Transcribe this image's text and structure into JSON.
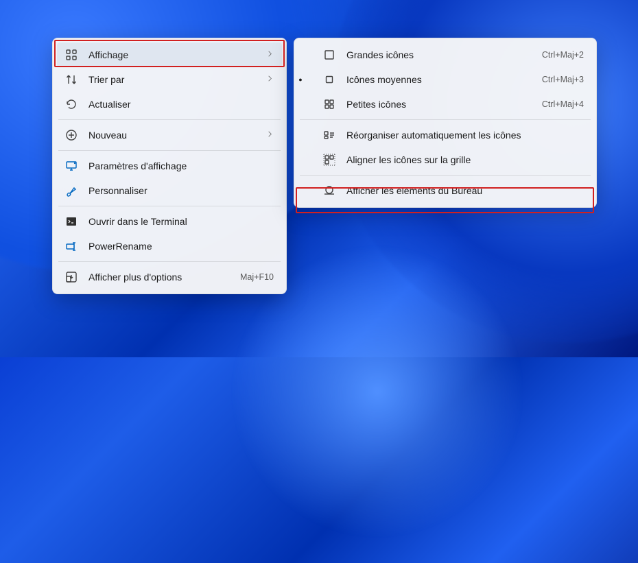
{
  "main_menu": {
    "view": "Affichage",
    "sort": "Trier par",
    "refresh": "Actualiser",
    "new": "Nouveau",
    "display_settings": "Paramètres d'affichage",
    "personalize": "Personnaliser",
    "open_terminal": "Ouvrir dans le Terminal",
    "powerrename": "PowerRename",
    "more_options": "Afficher plus d'options",
    "more_options_shortcut": "Maj+F10"
  },
  "sub_menu": {
    "large_icons": "Grandes icônes",
    "large_shortcut": "Ctrl+Maj+2",
    "medium_icons": "Icônes moyennes",
    "medium_shortcut": "Ctrl+Maj+3",
    "small_icons": "Petites icônes",
    "small_shortcut": "Ctrl+Maj+4",
    "auto_arrange": "Réorganiser automatiquement les icônes",
    "align_grid": "Aligner les icônes sur la grille",
    "show_desktop_items": "Afficher les éléments du Bureau"
  }
}
